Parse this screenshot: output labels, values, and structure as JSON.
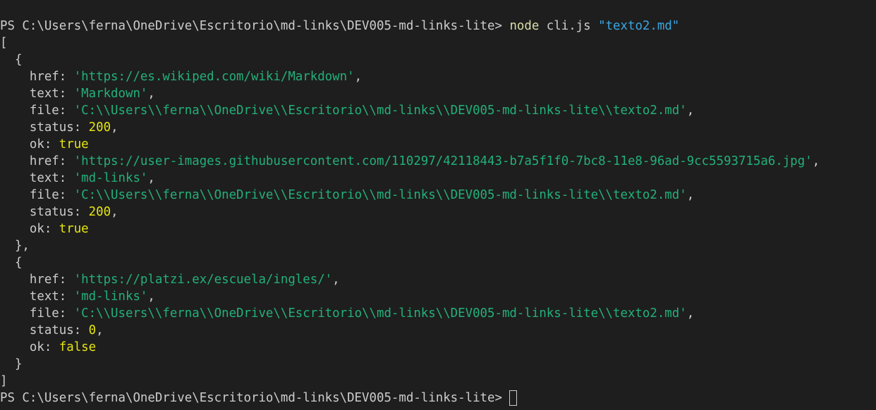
{
  "terminal": {
    "prompt1": {
      "path": "PS C:\\Users\\ferna\\OneDrive\\Escritorio\\md-links\\DEV005-md-links-lite> ",
      "command": "node",
      "args": " cli.js ",
      "arg_file": "\"texto2.md\""
    },
    "output": {
      "open_array": "[",
      "open_obj1": "  {",
      "obj1": {
        "href1_key": "    href: ",
        "href1_val": "'https://es.wikiped.com/wiki/Markdown'",
        "href1_end": ",",
        "text1_key": "    text: ",
        "text1_val": "'Markdown'",
        "text1_end": ",",
        "file1_key": "    file: ",
        "file1_val": "'C:\\\\Users\\\\ferna\\\\OneDrive\\\\Escritorio\\\\md-links\\\\DEV005-md-links-lite\\\\texto2.md'",
        "file1_end": ",",
        "status1_key": "    status: ",
        "status1_val": "200",
        "status1_end": ",",
        "ok1_key": "    ok: ",
        "ok1_val": "true",
        "href2_key": "    href: ",
        "href2_val": "'https://user-images.githubusercontent.com/110297/42118443-b7a5f1f0-7bc8-11e8-96ad-9cc5593715a6.jpg'",
        "href2_end": ",",
        "text2_key": "    text: ",
        "text2_val": "'md-links'",
        "text2_end": ",",
        "file2_key": "    file: ",
        "file2_val": "'C:\\\\Users\\\\ferna\\\\OneDrive\\\\Escritorio\\\\md-links\\\\DEV005-md-links-lite\\\\texto2.md'",
        "file2_end": ",",
        "status2_key": "    status: ",
        "status2_val": "200",
        "status2_end": ",",
        "ok2_key": "    ok: ",
        "ok2_val": "true"
      },
      "close_obj1": "  },",
      "open_obj2": "  {",
      "obj2": {
        "href_key": "    href: ",
        "href_val": "'https://platzi.ex/escuela/ingles/'",
        "href_end": ",",
        "text_key": "    text: ",
        "text_val": "'md-links'",
        "text_end": ",",
        "file_key": "    file: ",
        "file_val": "'C:\\\\Users\\\\ferna\\\\OneDrive\\\\Escritorio\\\\md-links\\\\DEV005-md-links-lite\\\\texto2.md'",
        "file_end": ",",
        "status_key": "    status: ",
        "status_val": "0",
        "status_end": ",",
        "ok_key": "    ok: ",
        "ok_val": "false"
      },
      "close_obj2": "  }",
      "close_array": "]"
    },
    "prompt2": {
      "path": "PS C:\\Users\\ferna\\OneDrive\\Escritorio\\md-links\\DEV005-md-links-lite> "
    },
    "colors": {
      "background": "#1e1e1e",
      "foreground": "#cccccc",
      "command": "#dcdcaa",
      "argument": "#3ba6e0",
      "string": "#23b07a",
      "number_boolean": "#e5e510"
    }
  }
}
